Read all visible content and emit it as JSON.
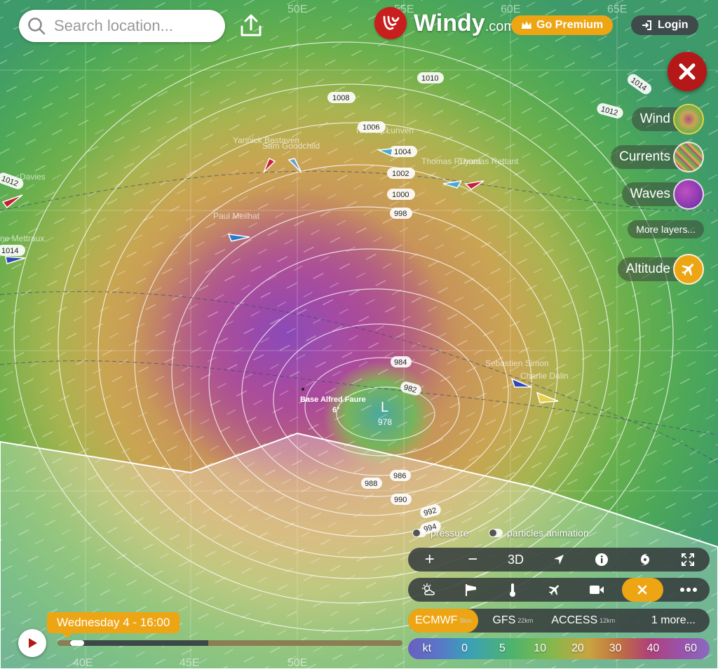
{
  "search": {
    "placeholder": "Search location..."
  },
  "brand": {
    "name": "Windy",
    "suffix": ".com"
  },
  "header": {
    "premium_label": "Go Premium",
    "login_label": "Login"
  },
  "layers": [
    {
      "label": "Wind"
    },
    {
      "label": "Currents"
    },
    {
      "label": "Waves"
    }
  ],
  "more_layers_label": "More layers...",
  "altitude_label": "Altitude",
  "toggles": {
    "pressure": "pressure",
    "particles": "particles animation"
  },
  "toolbar": {
    "zoom_in": "+",
    "zoom_out": "−",
    "view3d": "3D"
  },
  "models": [
    {
      "name": "ECMWF",
      "res": "9km"
    },
    {
      "name": "GFS",
      "res": "22km"
    },
    {
      "name": "ACCESS",
      "res": "12km"
    }
  ],
  "more_models": "1 more...",
  "legend": {
    "unit": "kt",
    "values": [
      "0",
      "5",
      "10",
      "20",
      "30",
      "40",
      "60"
    ]
  },
  "time": {
    "label": "Wednesday 4 - 16:00",
    "progress": 0.04
  },
  "map": {
    "longitudes": [
      "40E",
      "45E",
      "50E",
      "55E",
      "60E",
      "65E"
    ],
    "isobars": [
      "1010",
      "1014",
      "1012",
      "1008",
      "1006",
      "1004",
      "1002",
      "1000",
      "998",
      "984",
      "982",
      "988",
      "986",
      "990",
      "992",
      "994",
      "1012",
      "1014"
    ],
    "low": {
      "symbol": "L",
      "value": "978"
    },
    "station": {
      "name": "Base Alfred Faure",
      "temp": "6°"
    },
    "boats": [
      "Yannick Bestaven",
      "Sam Goodchild",
      "Nicolas Lunven",
      "Thomas Ruyant",
      "Thomas Rettant",
      "Paul Meilhat",
      "ne Mettraux",
      "Sebastien Simon",
      "Charlie Dalin",
      "Davies"
    ]
  }
}
